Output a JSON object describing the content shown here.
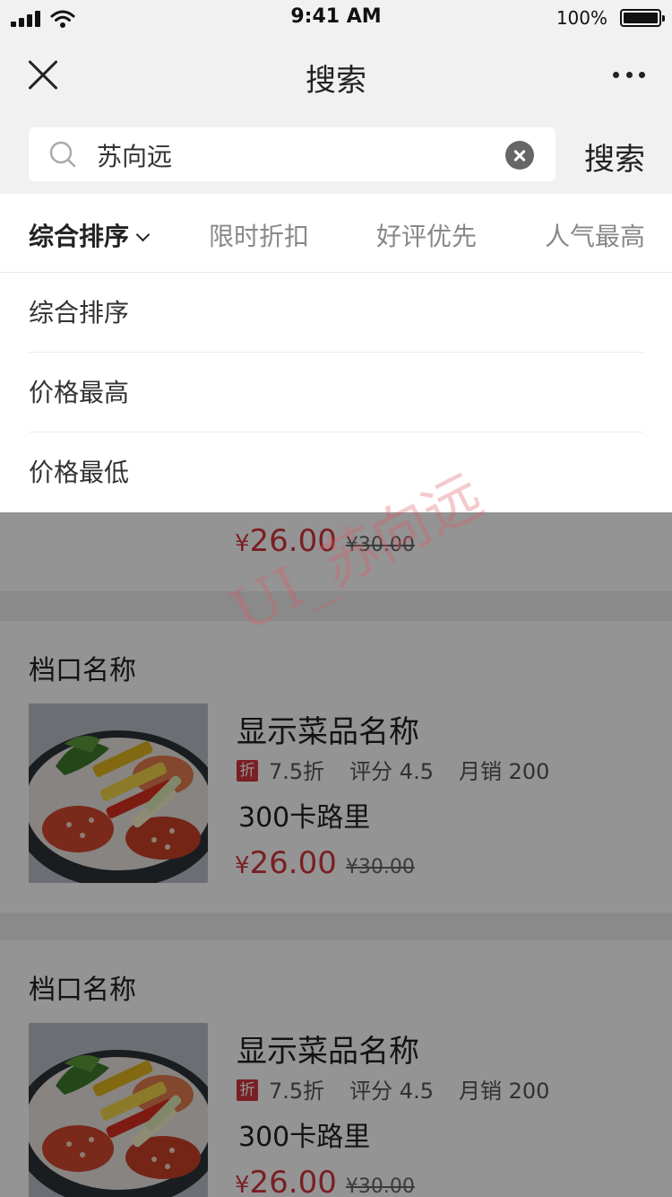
{
  "status_bar": {
    "time": "9:41 AM",
    "battery": "100%"
  },
  "nav": {
    "title": "搜索"
  },
  "search": {
    "value": "苏向远",
    "button_label": "搜索"
  },
  "sort_tabs": [
    {
      "label": "综合排序"
    },
    {
      "label": "限时折扣"
    },
    {
      "label": "好评优先"
    },
    {
      "label": "人气最高"
    }
  ],
  "sort_options": [
    {
      "label": "综合排序"
    },
    {
      "label": "价格最高"
    },
    {
      "label": "价格最低"
    }
  ],
  "list": [
    {
      "stall": "",
      "dish_name": "",
      "discount_badge": "",
      "discount": "",
      "rating": "",
      "monthly_sales": "",
      "calories": "",
      "currency": "¥",
      "price": "26.00",
      "original_price": "¥30.00"
    },
    {
      "stall": "档口名称",
      "dish_name": "显示菜品名称",
      "discount_badge": "折",
      "discount": "7.5折",
      "rating": "评分 4.5",
      "monthly_sales": "月销 200",
      "calories": "300卡路里",
      "currency": "¥",
      "price": "26.00",
      "original_price": "¥30.00"
    },
    {
      "stall": "档口名称",
      "dish_name": "显示菜品名称",
      "discount_badge": "折",
      "discount": "7.5折",
      "rating": "评分 4.5",
      "monthly_sales": "月销 200",
      "calories": "300卡路里",
      "currency": "¥",
      "price": "26.00",
      "original_price": "¥30.00"
    }
  ],
  "watermark": "UI_苏向远",
  "colors": {
    "accent": "#d2363e",
    "nav_bg": "#f1f1f1",
    "mask": "rgba(0,0,0,0.42)"
  },
  "icons": {
    "close": "close-icon",
    "more": "more-icon",
    "search": "search-icon",
    "clear": "clear-icon",
    "chevron": "chevron-down-icon"
  }
}
